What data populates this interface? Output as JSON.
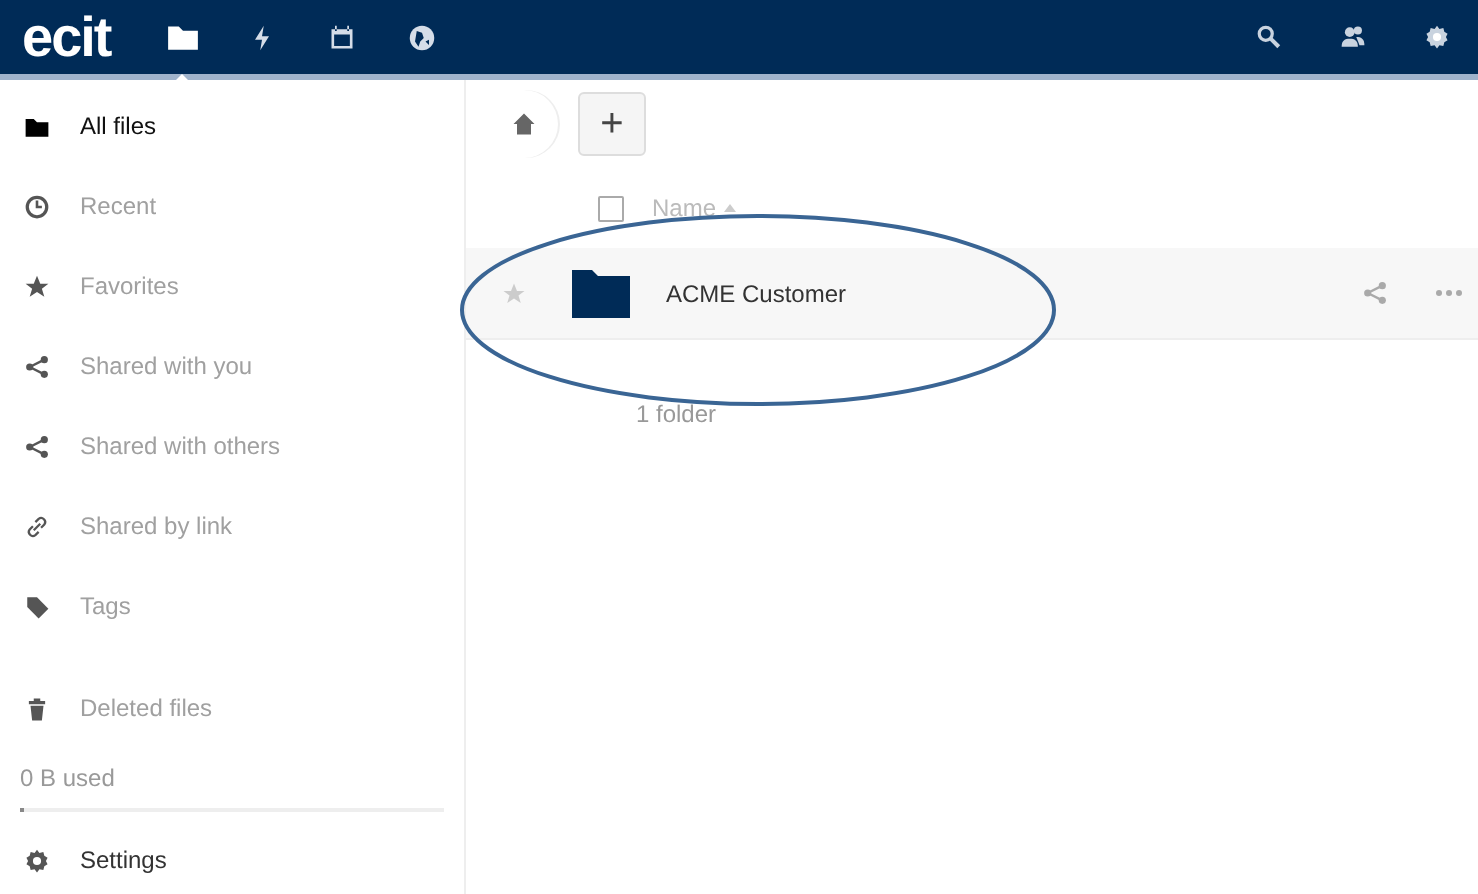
{
  "header": {
    "logo": "ecit",
    "apps": [
      {
        "kind": "files",
        "selected": true
      },
      {
        "kind": "activity",
        "selected": false
      },
      {
        "kind": "calendar",
        "selected": false
      },
      {
        "kind": "globe",
        "selected": false
      }
    ],
    "tools": [
      {
        "kind": "search"
      },
      {
        "kind": "contacts"
      },
      {
        "kind": "settings"
      }
    ]
  },
  "sidebar": {
    "items": [
      {
        "kind": "folder",
        "label": "All files",
        "selected": true
      },
      {
        "kind": "clock",
        "label": "Recent",
        "selected": false
      },
      {
        "kind": "star",
        "label": "Favorites",
        "selected": false
      },
      {
        "kind": "share",
        "label": "Shared with you",
        "selected": false
      },
      {
        "kind": "share",
        "label": "Shared with others",
        "selected": false
      },
      {
        "kind": "link",
        "label": "Shared by link",
        "selected": false
      },
      {
        "kind": "tag",
        "label": "Tags",
        "selected": false
      }
    ],
    "deleted": {
      "label": "Deleted files"
    },
    "quota": {
      "label": "0 B used",
      "level": 0.01
    },
    "settings": {
      "label": "Settings"
    }
  },
  "main": {
    "new_button": "+",
    "select_all_checked": false,
    "column": "Name",
    "files": [
      {
        "name": "ACME Customer",
        "favorite": false
      }
    ],
    "summary": "1 folder",
    "highlight_ellipse": true
  }
}
